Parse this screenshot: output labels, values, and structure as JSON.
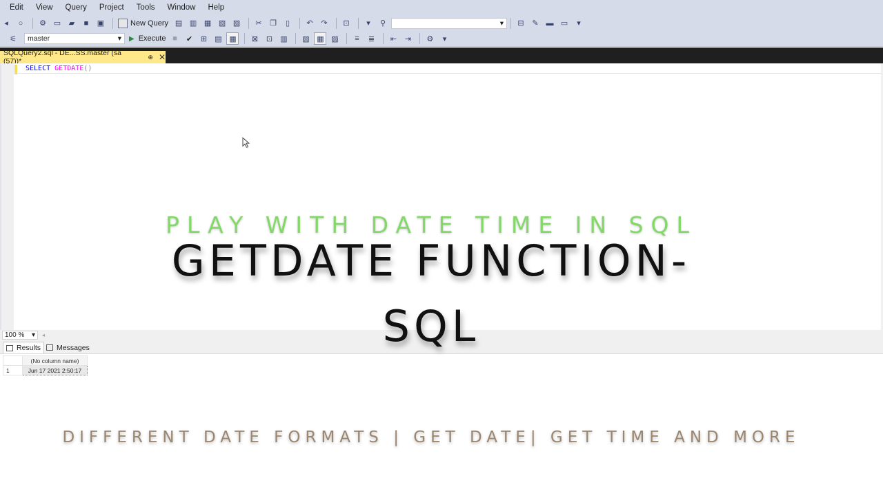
{
  "menu": [
    "Edit",
    "View",
    "Query",
    "Project",
    "Tools",
    "Window",
    "Help"
  ],
  "toolbar": {
    "new_query_label": "New Query",
    "execute_label": "Execute",
    "database": "master",
    "search_combo": ""
  },
  "tab": {
    "title": "SQLQuery2.sql - DE...SS.master (sa (57))*",
    "pin": "⊕",
    "close": "✕"
  },
  "editor": {
    "keyword": "SELECT",
    "function": "GETDATE",
    "parens": "()"
  },
  "zoom": "100 %",
  "results_tabs": {
    "results": "Results",
    "messages": "Messages"
  },
  "grid": {
    "header": "(No column name)",
    "row_number": "1",
    "value": "Jun 17 2021  2:50:17"
  },
  "overlay": {
    "tagline": "PLAY WITH DATE TIME IN SQL",
    "title_line1": "GETDATE FUNCTION-",
    "title_line2": "SQL",
    "subtitle": "DIFFERENT DATE FORMATS | GET DATE| GET TIME AND MORE"
  },
  "colors": {
    "chrome": "#d6dbe9",
    "tab_active": "#ffe88a",
    "tagline": "#6fd14f",
    "subtitle": "#9b8670"
  }
}
